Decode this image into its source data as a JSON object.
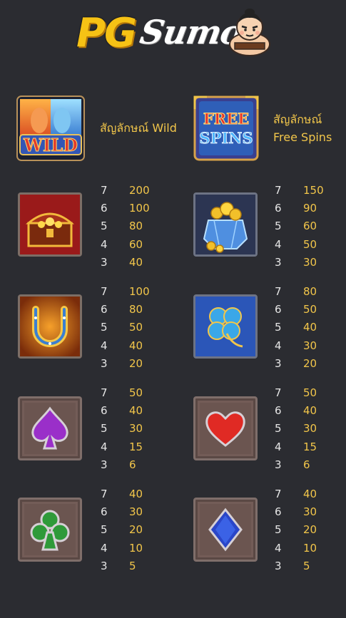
{
  "header": {
    "logo_text_pg": "PG",
    "logo_text_sumo": "Sumo"
  },
  "special_symbols": [
    {
      "name": "wild",
      "icon": "wild-symbol",
      "label": "สัญลักษณ์ Wild",
      "art_text": "WILD"
    },
    {
      "name": "free_spins",
      "icon": "free-spins-symbol",
      "label_line1": "สัญลักษณ์",
      "label_line2": "Free Spins",
      "art_text_1": "FREE",
      "art_text_2": "SPINS"
    }
  ],
  "symbols": [
    {
      "icon": "treasure-chest-icon",
      "pays": [
        [
          "7",
          "200"
        ],
        [
          "6",
          "100"
        ],
        [
          "5",
          "80"
        ],
        [
          "4",
          "60"
        ],
        [
          "3",
          "40"
        ]
      ]
    },
    {
      "icon": "gold-coin-bag-icon",
      "pays": [
        [
          "7",
          "150"
        ],
        [
          "6",
          "90"
        ],
        [
          "5",
          "60"
        ],
        [
          "4",
          "50"
        ],
        [
          "3",
          "30"
        ]
      ]
    },
    {
      "icon": "horseshoe-icon",
      "pays": [
        [
          "7",
          "100"
        ],
        [
          "6",
          "80"
        ],
        [
          "5",
          "50"
        ],
        [
          "4",
          "40"
        ],
        [
          "3",
          "20"
        ]
      ]
    },
    {
      "icon": "four-leaf-clover-icon",
      "pays": [
        [
          "7",
          "80"
        ],
        [
          "6",
          "50"
        ],
        [
          "5",
          "40"
        ],
        [
          "4",
          "30"
        ],
        [
          "3",
          "20"
        ]
      ]
    },
    {
      "icon": "spade-icon",
      "pays": [
        [
          "7",
          "50"
        ],
        [
          "6",
          "40"
        ],
        [
          "5",
          "30"
        ],
        [
          "4",
          "15"
        ],
        [
          "3",
          "6"
        ]
      ]
    },
    {
      "icon": "heart-icon",
      "pays": [
        [
          "7",
          "50"
        ],
        [
          "6",
          "40"
        ],
        [
          "5",
          "30"
        ],
        [
          "4",
          "15"
        ],
        [
          "3",
          "6"
        ]
      ]
    },
    {
      "icon": "club-icon",
      "pays": [
        [
          "7",
          "40"
        ],
        [
          "6",
          "30"
        ],
        [
          "5",
          "20"
        ],
        [
          "4",
          "10"
        ],
        [
          "3",
          "5"
        ]
      ]
    },
    {
      "icon": "diamond-icon",
      "pays": [
        [
          "7",
          "40"
        ],
        [
          "6",
          "30"
        ],
        [
          "5",
          "20"
        ],
        [
          "4",
          "10"
        ],
        [
          "3",
          "5"
        ]
      ]
    }
  ],
  "colors": {
    "background": "#2b2c31",
    "value_gold": "#f2c64a",
    "count_white": "#e6e6e6"
  }
}
